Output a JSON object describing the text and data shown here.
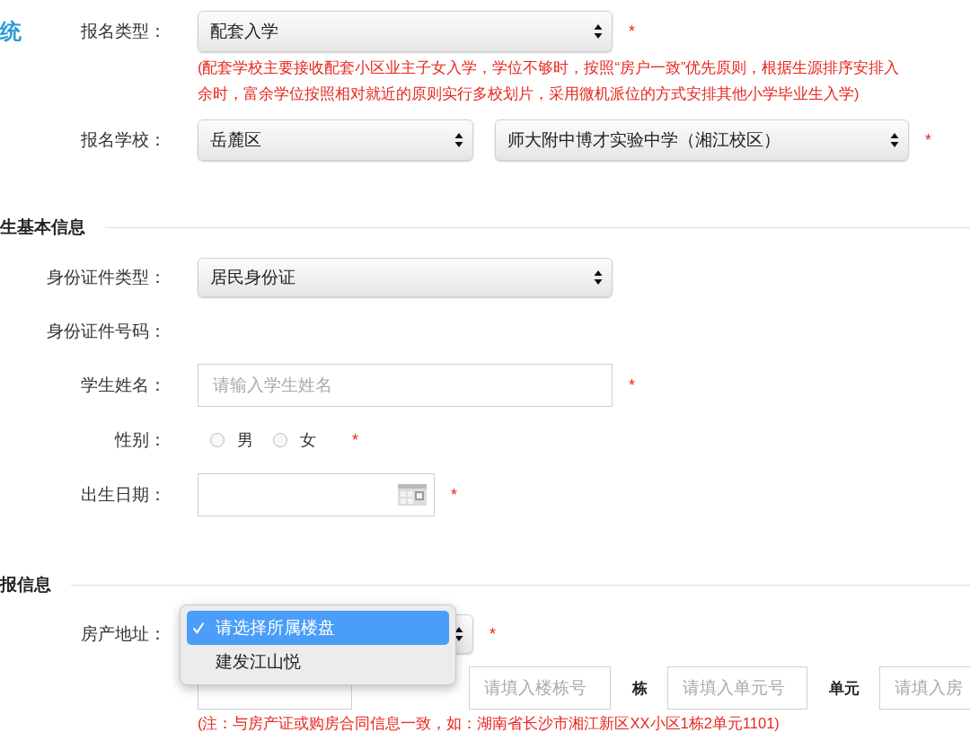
{
  "rows": [
    {
      "kind": "select",
      "title": "统",
      "label": "报名类型：",
      "value": "配套入学",
      "mark": "*"
    },
    {
      "kind": "note",
      "lines": [
        "(配套学校主要接收配套小区业主子女入学，学位不够时，按照“房户一致”优先原则，根据生源排序安排入",
        "余时，富余学位按照相对就近的原则实行多校划片，采用微机派位的方式安排其他小学毕业生入学)"
      ]
    },
    {
      "kind": "select_pair",
      "label": "报名学校：",
      "selects": [
        {
          "value": "岳麓区"
        },
        {
          "value": "师大附中博才实验中学（湘江校区）"
        }
      ],
      "mark": "*"
    },
    {
      "kind": "section",
      "title": "生基本信息"
    },
    {
      "kind": "select",
      "label": "身份证件类型：",
      "value": "居民身份证"
    },
    {
      "kind": "plain",
      "label": "身份证件号码："
    },
    {
      "kind": "input",
      "label": "学生姓名：",
      "placeholder": "请输入学生姓名",
      "mark": "*"
    },
    {
      "kind": "radio",
      "label": "性别：",
      "options": [
        {
          "label": "男",
          "selected": false
        },
        {
          "label": "女",
          "selected": false
        }
      ],
      "mark": "*"
    },
    {
      "kind": "date",
      "label": "出生日期：",
      "mark": "*"
    },
    {
      "kind": "section",
      "title": "报信息"
    },
    {
      "kind": "dropdown",
      "label": "房产地址：",
      "mark": "*",
      "menu": [
        {
          "label": "请选择所属楼盘",
          "selected": true
        },
        {
          "label": "建发江山悦",
          "selected": false
        }
      ]
    },
    {
      "kind": "units",
      "fields": [
        {
          "placeholder": "请填入楼栋号",
          "unit": "栋"
        },
        {
          "placeholder": "请填入单元号",
          "unit": "单元"
        },
        {
          "placeholder": "请填入房"
        }
      ]
    },
    {
      "kind": "note",
      "lines": [
        "(注：与房产证或购房合同信息一致，如：湖南省长沙市湘江新区XX小区1栋2单元1101)"
      ]
    }
  ]
}
